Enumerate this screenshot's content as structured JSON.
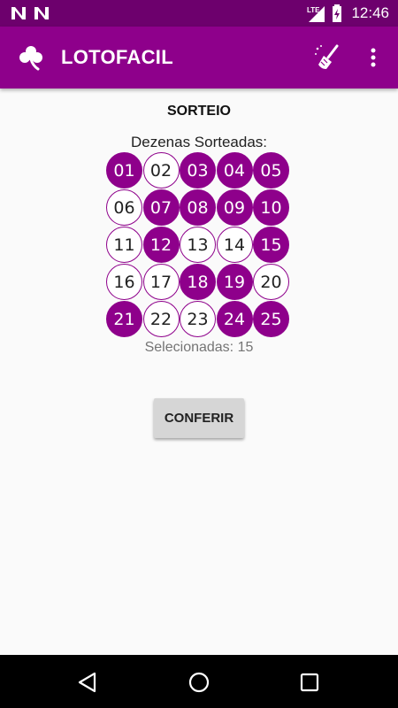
{
  "status_bar": {
    "time": "12:46",
    "network_label": "LTE",
    "icons": [
      "notification-n-icon",
      "notification-n-icon",
      "signal-icon",
      "battery-icon"
    ]
  },
  "app_bar": {
    "title": "LOTOFACIL",
    "logo_icon": "clover-icon",
    "actions": [
      "broom-icon",
      "more-vert-icon"
    ],
    "background_color": "#8e008b"
  },
  "main": {
    "section_title": "SORTEIO",
    "grid_label": "Dezenas Sorteadas:",
    "numbers": [
      {
        "label": "01",
        "selected": true
      },
      {
        "label": "02",
        "selected": false
      },
      {
        "label": "03",
        "selected": true
      },
      {
        "label": "04",
        "selected": true
      },
      {
        "label": "05",
        "selected": true
      },
      {
        "label": "06",
        "selected": false
      },
      {
        "label": "07",
        "selected": true
      },
      {
        "label": "08",
        "selected": true
      },
      {
        "label": "09",
        "selected": true
      },
      {
        "label": "10",
        "selected": true
      },
      {
        "label": "11",
        "selected": false
      },
      {
        "label": "12",
        "selected": true
      },
      {
        "label": "13",
        "selected": false
      },
      {
        "label": "14",
        "selected": false
      },
      {
        "label": "15",
        "selected": true
      },
      {
        "label": "16",
        "selected": false
      },
      {
        "label": "17",
        "selected": false
      },
      {
        "label": "18",
        "selected": true
      },
      {
        "label": "19",
        "selected": true
      },
      {
        "label": "20",
        "selected": false
      },
      {
        "label": "21",
        "selected": true
      },
      {
        "label": "22",
        "selected": false
      },
      {
        "label": "23",
        "selected": false
      },
      {
        "label": "24",
        "selected": true
      },
      {
        "label": "25",
        "selected": true
      }
    ],
    "selected_count_text": "Selecionadas: 15",
    "check_button_label": "CONFERIR",
    "selected_color": "#8e008b"
  },
  "nav_bar": {
    "icons": [
      "back-icon",
      "home-icon",
      "recents-icon"
    ]
  }
}
